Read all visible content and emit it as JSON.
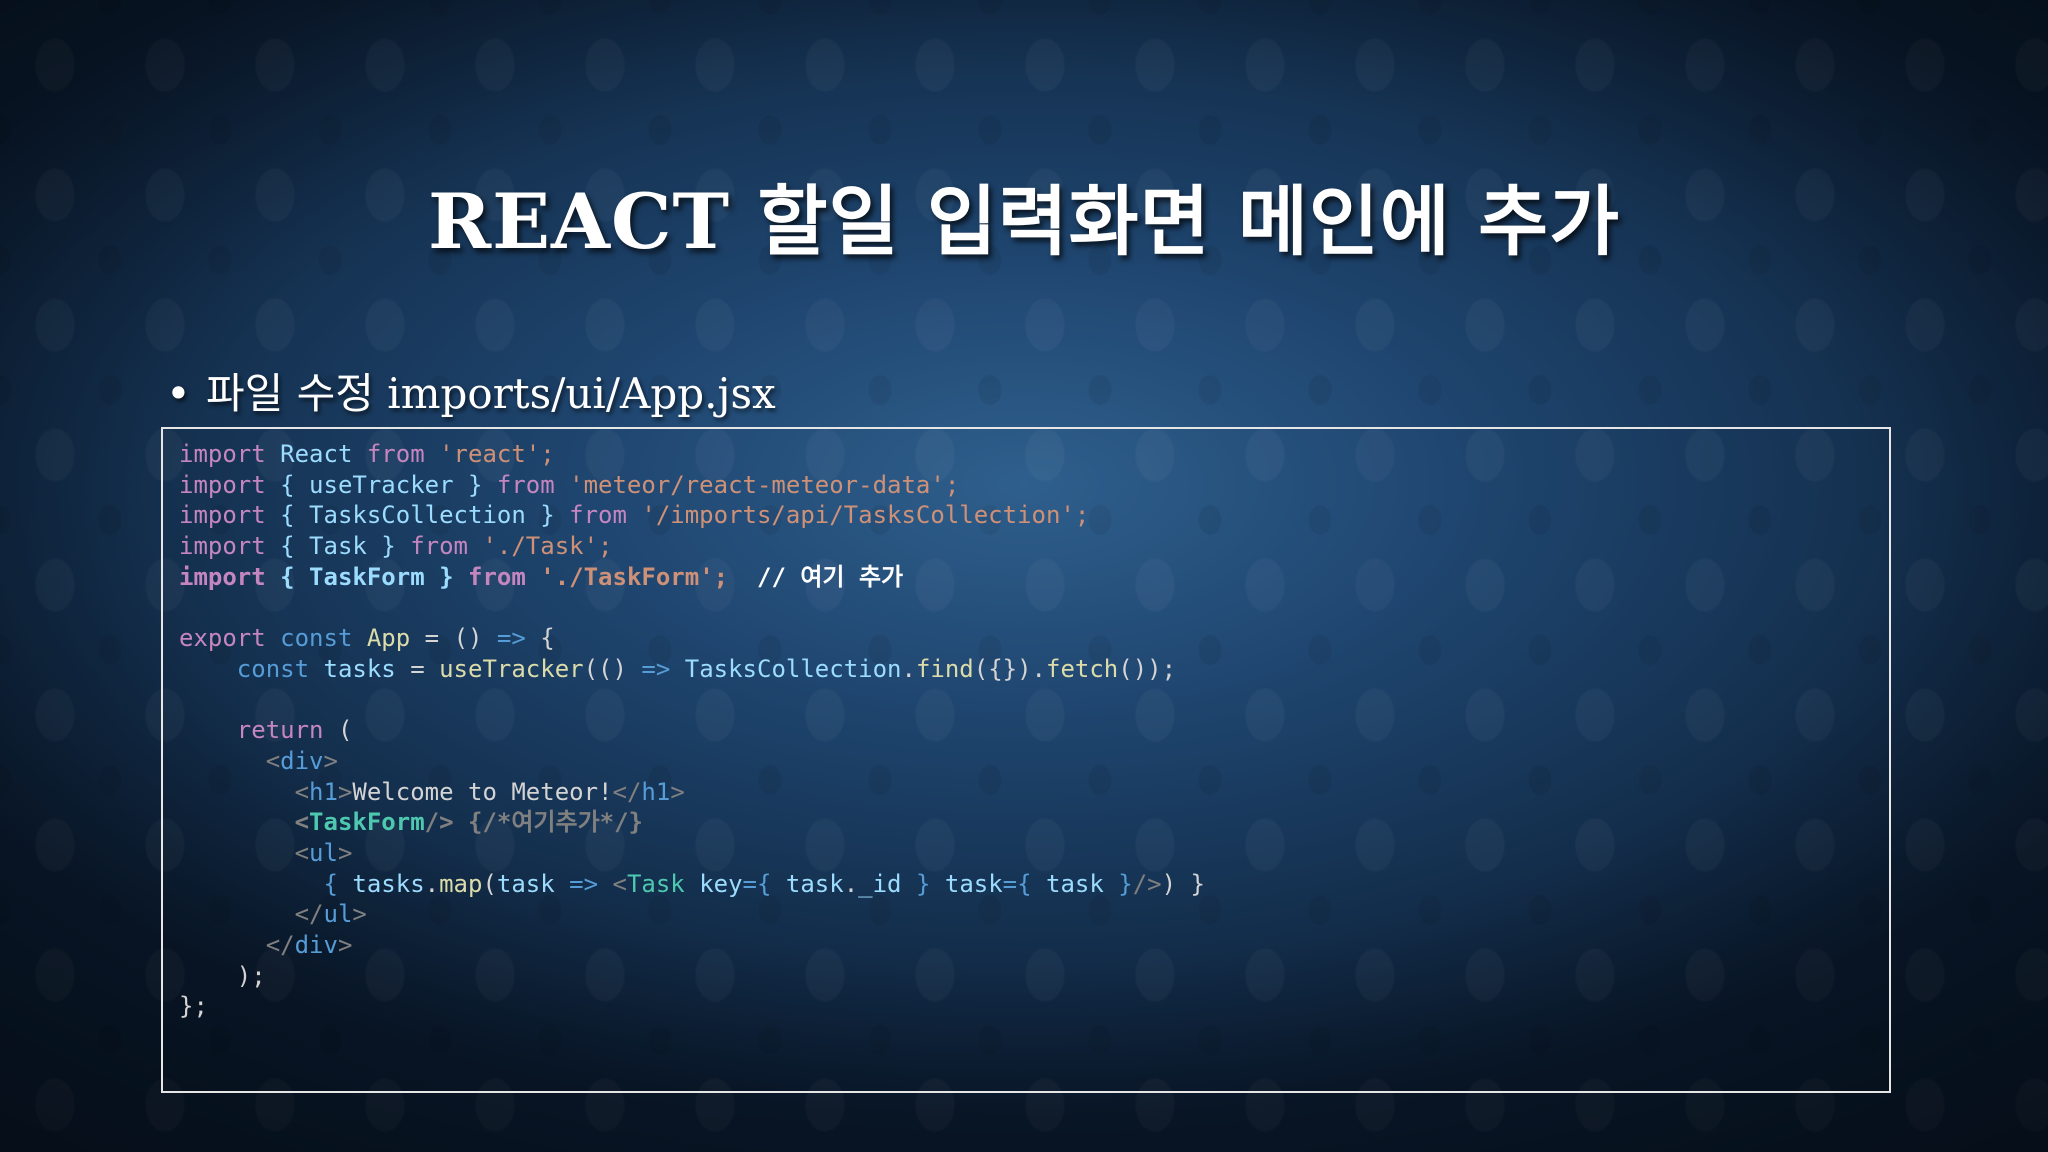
{
  "slide": {
    "title": "REACT 할일 입력화면 메인에 추가",
    "bullet_marker": "•",
    "bullet_text": "파일 수정 imports/ui/App.jsx"
  },
  "code": {
    "l1": [
      "import",
      " React ",
      "from",
      " 'react';"
    ],
    "l2": [
      "import",
      " { useTracker } ",
      "from",
      " 'meteor/react-meteor-data';"
    ],
    "l3": [
      "import",
      " { TasksCollection } ",
      "from",
      " '/imports/api/TasksCollection';"
    ],
    "l4": [
      "import",
      " { Task } ",
      "from",
      " './Task';"
    ],
    "l5": [
      "import",
      " { TaskForm } ",
      "from",
      " './TaskForm';",
      "  // 여기 추가"
    ],
    "l7": [
      "export",
      " const ",
      "App",
      " = () ",
      "=>",
      " {"
    ],
    "l8": [
      "    const ",
      "tasks",
      " = ",
      "useTracker",
      "(() ",
      "=>",
      " TasksCollection",
      ".",
      "find",
      "({}).",
      "fetch",
      "());"
    ],
    "l10": [
      "    return",
      " ("
    ],
    "l11": [
      "      <",
      "div",
      ">"
    ],
    "l12": [
      "        <",
      "h1",
      ">",
      "Welcome to Meteor!",
      "</",
      "h1",
      ">"
    ],
    "l13": [
      "        <",
      "TaskForm",
      "/>",
      " {/*여기추가*/}"
    ],
    "l14": [
      "        <",
      "ul",
      ">"
    ],
    "l15": [
      "          { ",
      "tasks",
      ".",
      "map",
      "(",
      "task",
      " => ",
      "<",
      "Task",
      " key",
      "={",
      " task",
      ".",
      "_id",
      " }",
      " task",
      "={",
      " task",
      " }",
      "/>",
      ") }"
    ],
    "l16": [
      "        </",
      "ul",
      ">"
    ],
    "l17": [
      "      </",
      "div",
      ">"
    ],
    "l18": [
      "    );"
    ],
    "l19": [
      "};"
    ]
  }
}
